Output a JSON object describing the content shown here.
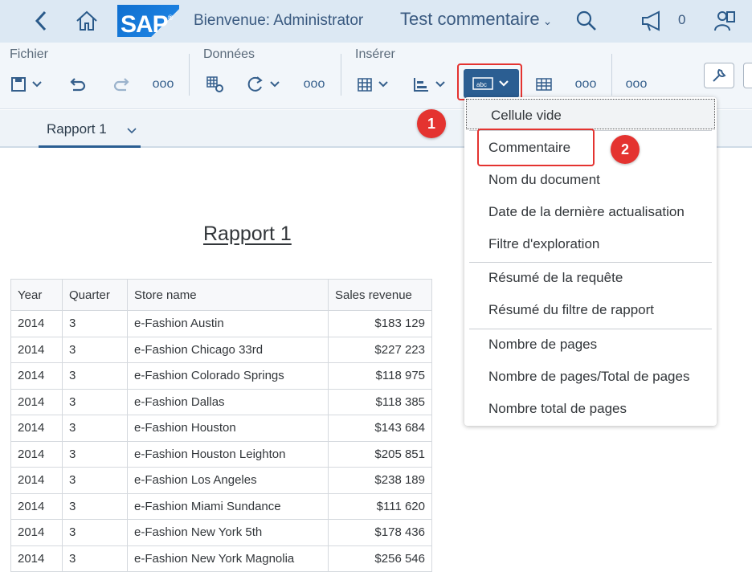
{
  "shell": {
    "logo_text": "SAP",
    "logo_mark": "®",
    "welcome": "Bienvenue: Administrator",
    "document_title": "Test commentaire",
    "notification_count": "0",
    "icons": [
      "back-icon",
      "home-icon",
      "search-icon",
      "megaphone-icon",
      "user-settings-icon"
    ]
  },
  "toolbar": {
    "groups": [
      "Fichier",
      "Données",
      "Insérer"
    ],
    "more": "ooo"
  },
  "tabs": [
    {
      "label": "Rapport 1"
    }
  ],
  "report": {
    "title": "Rapport 1",
    "columns": [
      "Year",
      "Quarter",
      "Store name",
      "Sales revenue"
    ],
    "rows": [
      [
        "2014",
        "3",
        "e-Fashion Austin",
        "$183 129"
      ],
      [
        "2014",
        "3",
        "e-Fashion Chicago 33rd",
        "$227 223"
      ],
      [
        "2014",
        "3",
        "e-Fashion Colorado Springs",
        "$118 975"
      ],
      [
        "2014",
        "3",
        "e-Fashion Dallas",
        "$118 385"
      ],
      [
        "2014",
        "3",
        "e-Fashion Houston",
        "$143 684"
      ],
      [
        "2014",
        "3",
        "e-Fashion Houston Leighton",
        "$205 851"
      ],
      [
        "2014",
        "3",
        "e-Fashion Los Angeles",
        "$238 189"
      ],
      [
        "2014",
        "3",
        "e-Fashion Miami Sundance",
        "$111 620"
      ],
      [
        "2014",
        "3",
        "e-Fashion New York 5th",
        "$178 436"
      ],
      [
        "2014",
        "3",
        "e-Fashion New York Magnolia",
        "$256 546"
      ]
    ]
  },
  "menu": {
    "items": [
      "Cellule vide",
      "Commentaire",
      "Nom du document",
      "Date de la dernière actualisation",
      "Filtre d'exploration",
      "Résumé de la requête",
      "Résumé du filtre de rapport",
      "Nombre de pages",
      "Nombre de pages/Total de pages",
      "Nombre total de pages"
    ]
  },
  "annotations": {
    "step1": "1",
    "step2": "2",
    "highlight_color": "#e43330"
  },
  "colors": {
    "shell_bg": "#dce8f3",
    "toolbar_bg": "#f2f6fa",
    "accent": "#2b5e92"
  }
}
